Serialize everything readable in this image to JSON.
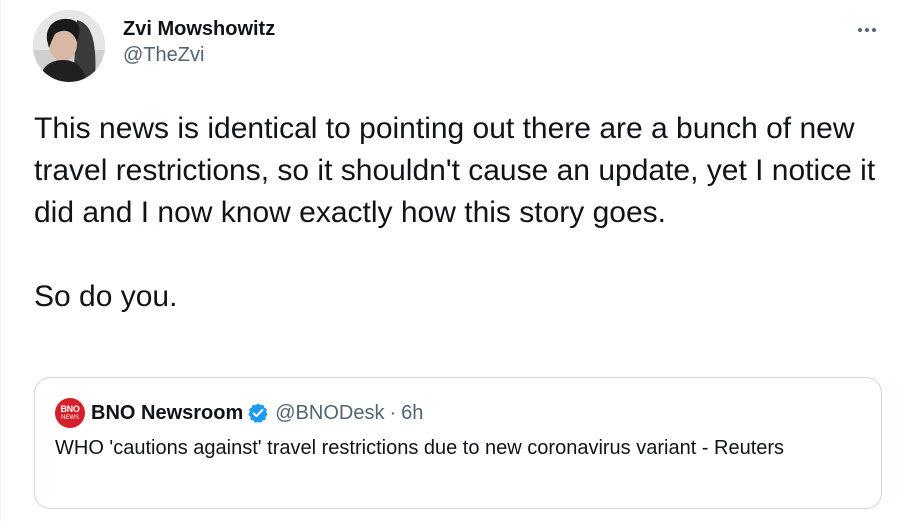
{
  "tweet": {
    "author_name": "Zvi Mowshowitz",
    "author_handle": "@TheZvi",
    "more_icon": "more-horizontal-icon",
    "text": "This news is identical to pointing out there are a bunch of new travel restrictions, so it shouldn't cause an update, yet I notice it did and I now know exactly how this story goes.\n\nSo do you."
  },
  "quote": {
    "avatar_text_top": "BNO",
    "avatar_text_bottom": "NEWS",
    "author_name": "BNO Newsroom",
    "verified_icon": "verified-badge-icon",
    "author_handle": "@BNODesk",
    "separator": "·",
    "time": "6h",
    "text": "WHO 'cautions against' travel restrictions due to new coronavirus variant - Reuters"
  },
  "colors": {
    "text_primary": "#0f1419",
    "text_secondary": "#536471",
    "card_border": "#cfd9de",
    "verified_blue": "#1d9bf0",
    "bno_red": "#d4202a"
  }
}
